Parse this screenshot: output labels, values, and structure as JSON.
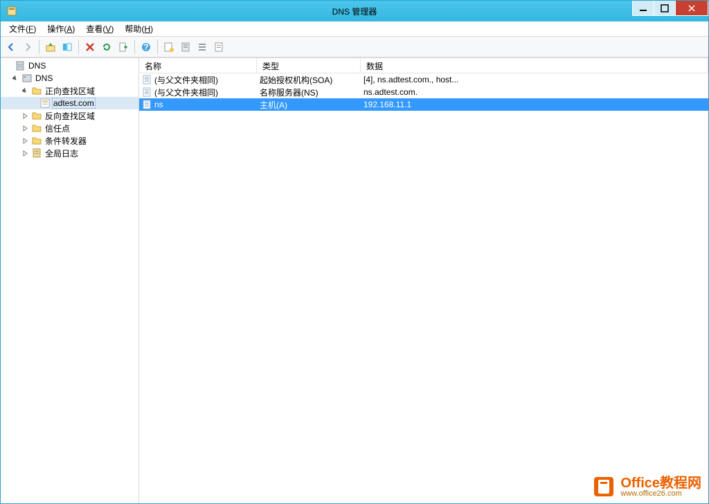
{
  "title": "DNS 管理器",
  "menubar": [
    {
      "label": "文件",
      "key": "F"
    },
    {
      "label": "操作",
      "key": "A"
    },
    {
      "label": "查看",
      "key": "V"
    },
    {
      "label": "帮助",
      "key": "H"
    }
  ],
  "tree": {
    "root": "DNS",
    "server": "DNS",
    "nodes": {
      "forward": "正向查找区域",
      "zone": "adtest.com",
      "reverse": "反向查找区域",
      "trust": "信任点",
      "conditional": "条件转发器",
      "global_logs": "全局日志"
    }
  },
  "columns": {
    "name": "名称",
    "type": "类型",
    "data": "数据"
  },
  "records": [
    {
      "name": "(与父文件夹相同)",
      "type": "起始授权机构(SOA)",
      "data": "[4], ns.adtest.com., host..."
    },
    {
      "name": "(与父文件夹相同)",
      "type": "名称服务器(NS)",
      "data": "ns.adtest.com."
    },
    {
      "name": "ns",
      "type": "主机(A)",
      "data": "192.168.11.1",
      "selected": true
    }
  ],
  "watermark": {
    "line1": "Office教程网",
    "line2": "www.office26.com"
  }
}
